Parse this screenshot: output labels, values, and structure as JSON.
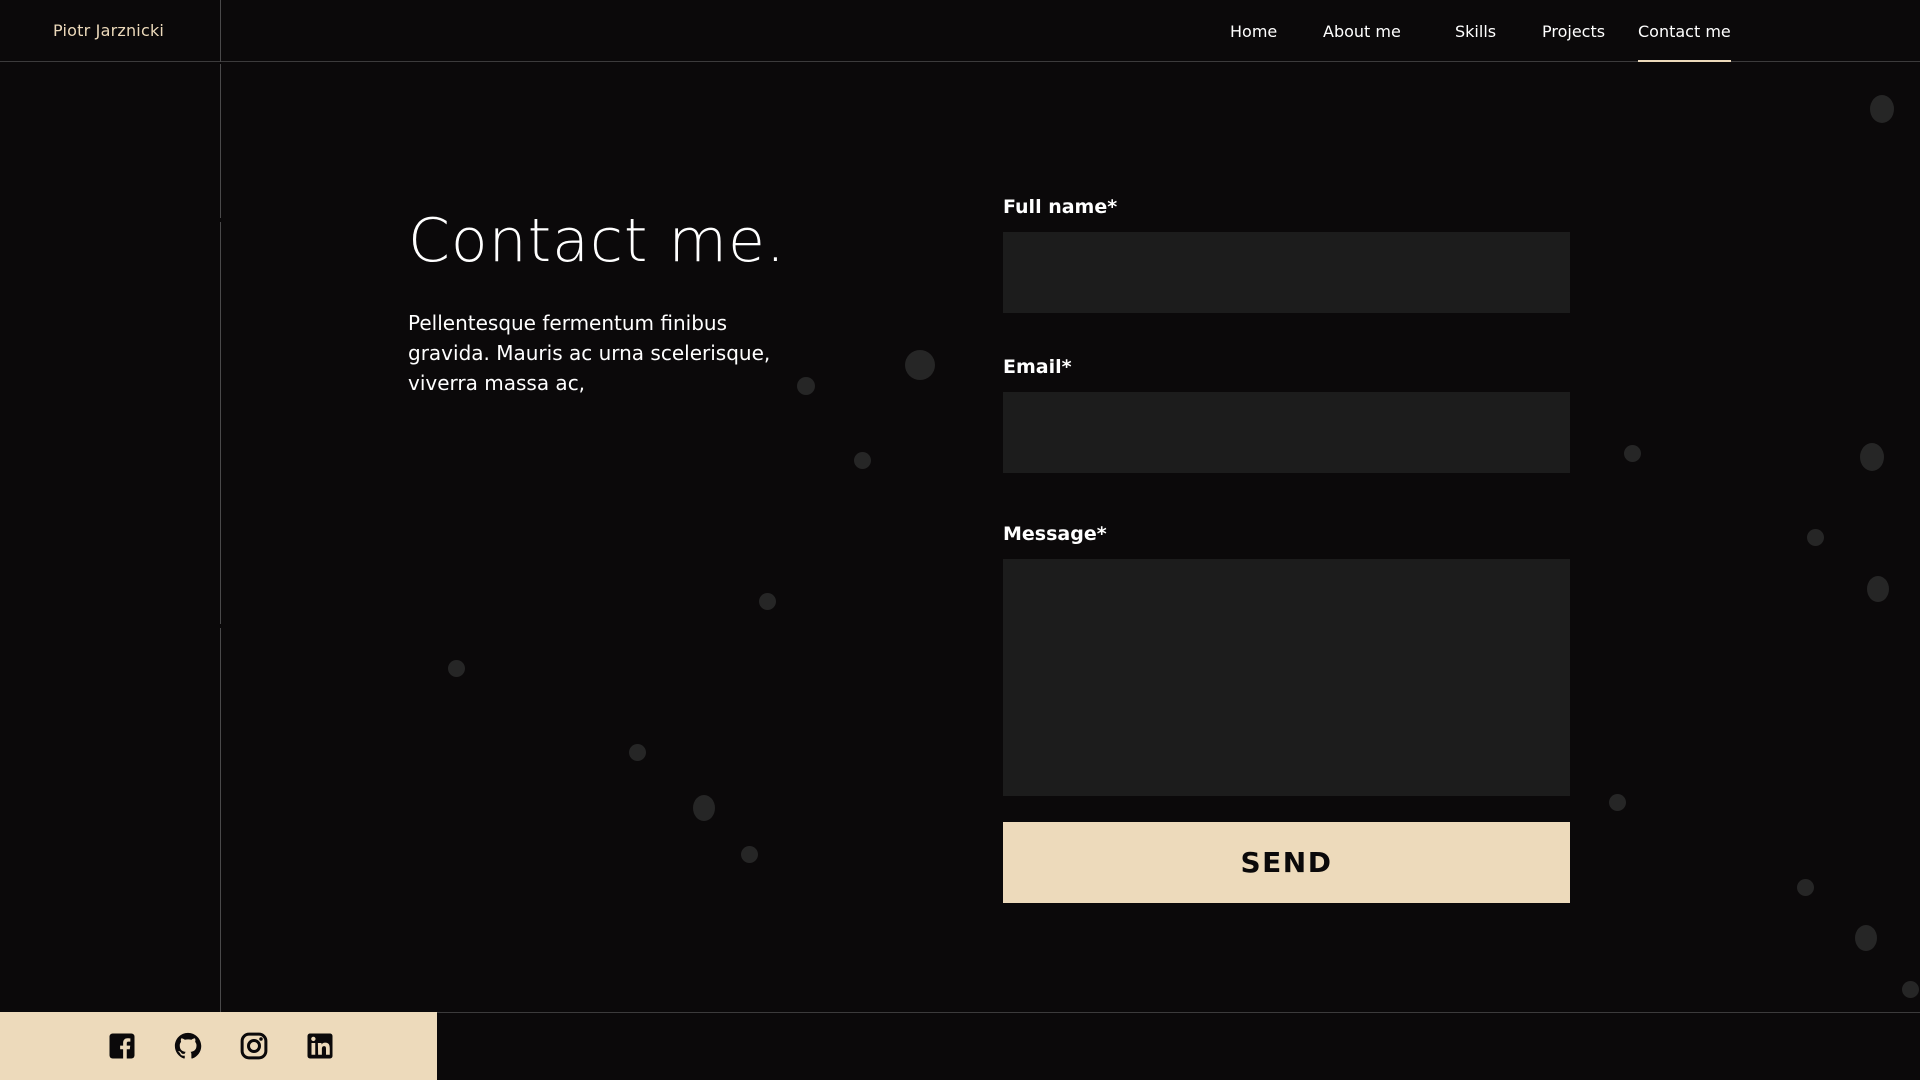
{
  "brand": {
    "name": "Piotr Jarznicki"
  },
  "nav": {
    "items": [
      {
        "label": "Home"
      },
      {
        "label": "About me"
      },
      {
        "label": "Skills"
      },
      {
        "label": "Projects"
      },
      {
        "label": "Contact me",
        "active": true
      }
    ]
  },
  "contact": {
    "title": "Contact me.",
    "description": "Pellentesque fermentum finibus gravida. Mauris ac urna scelerisque, viverra massa ac,"
  },
  "form": {
    "full_name": {
      "label": "Full name*",
      "value": ""
    },
    "email": {
      "label": "Email*",
      "value": ""
    },
    "message": {
      "label": "Message*",
      "value": ""
    },
    "submit_label": "SEND"
  },
  "social": [
    {
      "icon": "facebook-icon"
    },
    {
      "icon": "github-icon"
    },
    {
      "icon": "instagram-icon"
    },
    {
      "icon": "linkedin-icon"
    }
  ],
  "colors": {
    "background": "#0b090a",
    "accent": "#eddabb",
    "field_background": "#1c1c1c",
    "text": "#ffffff"
  }
}
